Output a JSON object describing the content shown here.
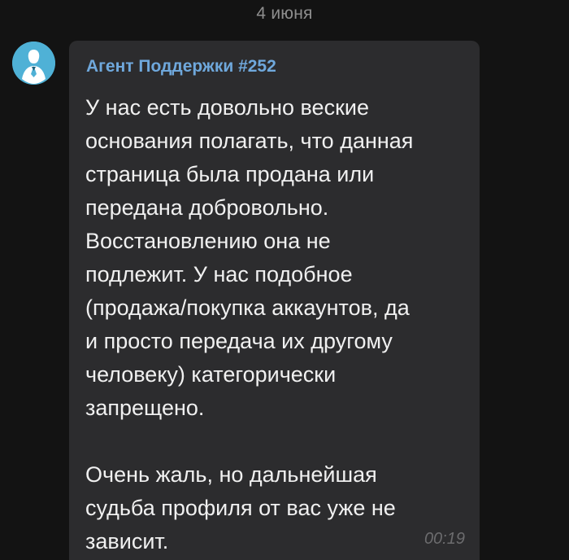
{
  "chat": {
    "date_divider": "4 июня"
  },
  "message": {
    "sender": "Агент Поддержки #252",
    "text": "У нас есть довольно веские\nоснования полагать, что данная\nстраница была продана или\nпередана добровольно.\nВосстановлению она не\nподлежит. У нас подобное\n(продажа/покупка аккаунтов, да\nи просто передача их другому\nчеловеку) категорически\nзапрещено.\n\nОчень жаль, но дальнейшая\nсудьба профиля от вас уже не\nзависит.",
    "time": "00:19",
    "avatar_icon": "support-agent-avatar-icon",
    "avatar_color": "#4fb1d6",
    "sender_color": "#6fa8dc",
    "bubble_color": "#2c2c2e"
  }
}
